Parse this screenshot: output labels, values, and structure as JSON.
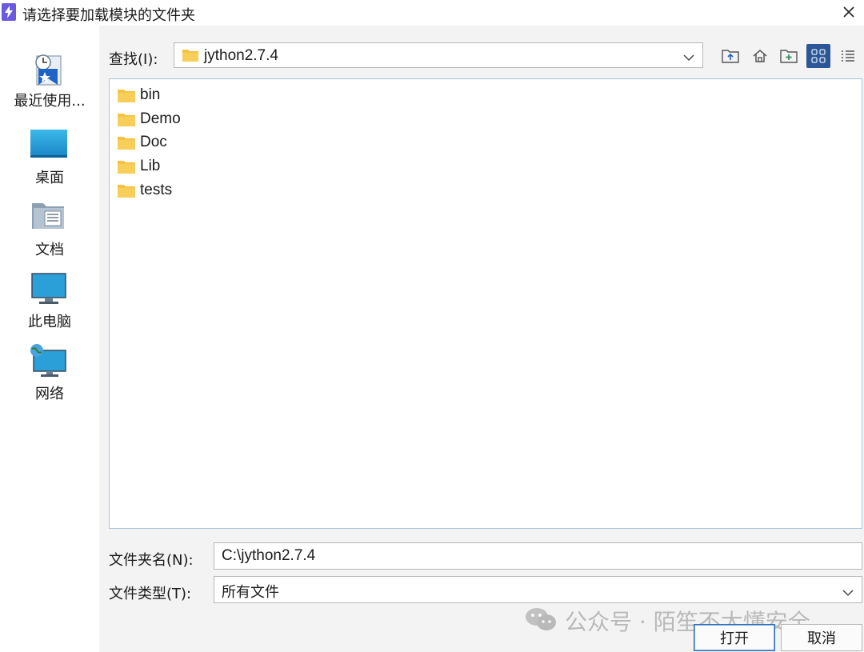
{
  "window": {
    "title": "请选择要加载模块的文件夹"
  },
  "places": [
    {
      "label": "最近使用...",
      "icon": "recent-places-icon"
    },
    {
      "label": "桌面",
      "icon": "desktop-icon"
    },
    {
      "label": "文档",
      "icon": "documents-icon"
    },
    {
      "label": "此电脑",
      "icon": "this-pc-icon"
    },
    {
      "label": "网络",
      "icon": "network-icon"
    }
  ],
  "lookin": {
    "label": "查找(I):",
    "value": "jython2.7.4"
  },
  "toolbar": {
    "icons": [
      "up-folder-icon",
      "home-icon",
      "new-folder-icon",
      "list-view-icon",
      "details-view-icon"
    ]
  },
  "files": [
    {
      "name": "bin"
    },
    {
      "name": "Demo"
    },
    {
      "name": "Doc"
    },
    {
      "name": "Lib"
    },
    {
      "name": "tests"
    }
  ],
  "folder_name": {
    "label": "文件夹名(N):",
    "value": "C:\\jython2.7.4"
  },
  "file_type": {
    "label": "文件类型(T):",
    "value": "所有文件"
  },
  "buttons": {
    "open": "打开",
    "cancel": "取消"
  },
  "watermark": {
    "text": "公众号 · 陌笙不太懂安全"
  },
  "colors": {
    "accent": "#2b5797",
    "folder": "#f5c242",
    "list_border": "#a9c3e0"
  }
}
